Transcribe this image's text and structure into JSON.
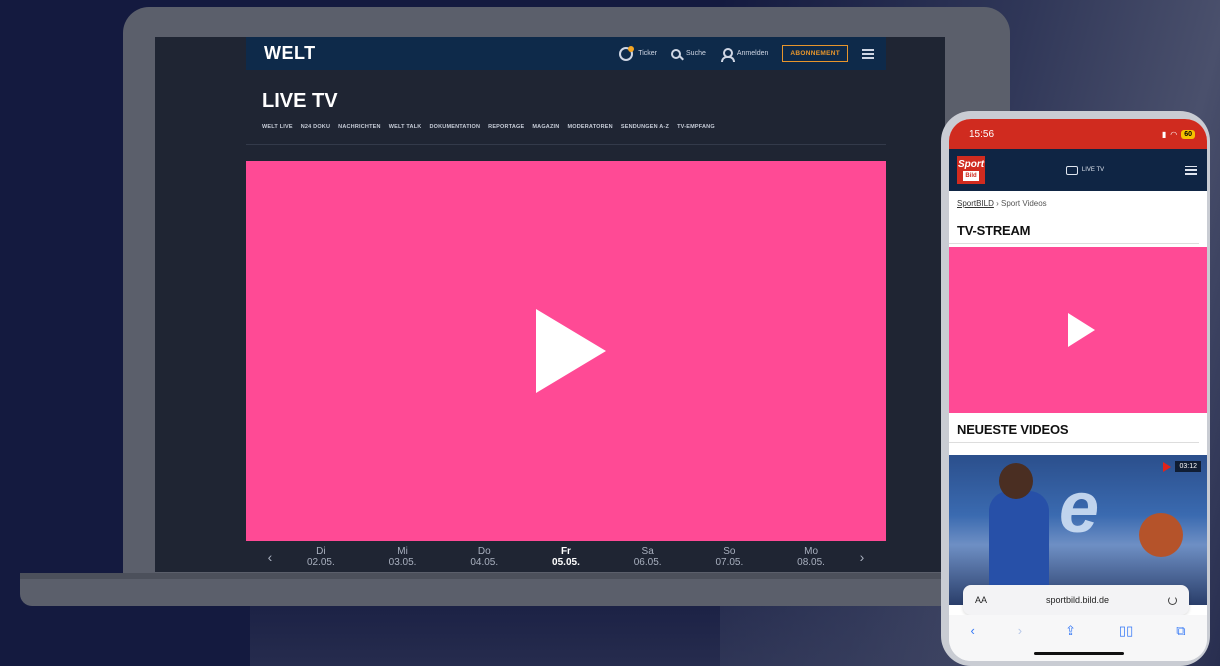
{
  "welt": {
    "logo": "WELT",
    "header": {
      "ticker": "Ticker",
      "search": "Suche",
      "login": "Anmelden",
      "subscription": "ABONNEMENT"
    },
    "page_title": "LIVE TV",
    "nav": [
      "WELT LIVE",
      "N24 DOKU",
      "NACHRICHTEN",
      "WELT TALK",
      "DOKUMENTATION",
      "REPORTAGE",
      "MAGAZIN",
      "MODERATOREN",
      "SENDUNGEN A-Z",
      "TV-EMPFANG"
    ],
    "dates": [
      {
        "day": "Di",
        "date": "02.05."
      },
      {
        "day": "Mi",
        "date": "03.05."
      },
      {
        "day": "Do",
        "date": "04.05."
      },
      {
        "day": "Fr",
        "date": "05.05."
      },
      {
        "day": "Sa",
        "date": "06.05."
      },
      {
        "day": "So",
        "date": "07.05."
      },
      {
        "day": "Mo",
        "date": "08.05."
      }
    ],
    "arrow_prev": "‹",
    "arrow_next": "›",
    "colors": {
      "player": "#ff4a95",
      "header": "#0e2a4a",
      "accent": "#e8962c"
    }
  },
  "sportbild": {
    "status_time": "15:56",
    "battery": "60",
    "logo_top": "Sport",
    "logo_bottom": "Bild",
    "live_label": "LIVE TV",
    "breadcrumb_home": "SportBILD",
    "breadcrumb_sep": " › ",
    "breadcrumb_page": "Sport Videos",
    "section_title": "TV-STREAM",
    "newest_title": "NEUESTE VIDEOS",
    "video_duration": "03:12",
    "url_aa": "AA",
    "url": "sportbild.bild.de",
    "colors": {
      "status_bar": "#d02b1f",
      "header": "#0f2544",
      "player": "#ff4a95"
    }
  }
}
